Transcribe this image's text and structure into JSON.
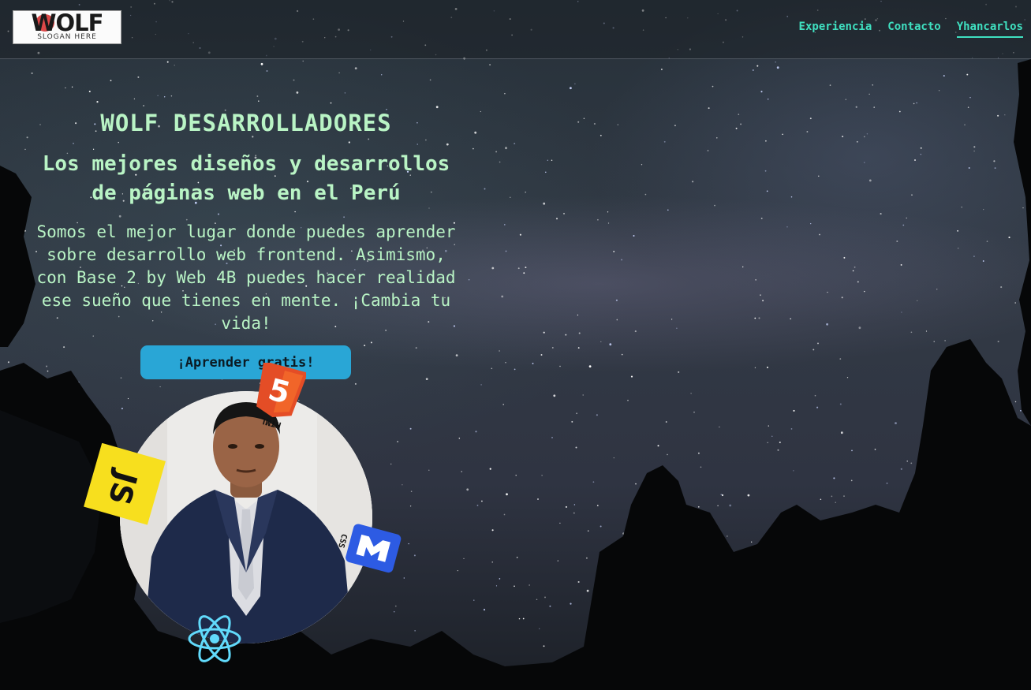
{
  "header": {
    "logo": {
      "word": "WOLF",
      "slogan": "SLOGAN HERE"
    },
    "nav": [
      {
        "label": "Experiencia",
        "active": false
      },
      {
        "label": "Contacto",
        "active": false
      },
      {
        "label": "Yhancarlos",
        "active": true
      }
    ]
  },
  "hero": {
    "title": "WOLF DESARROLLADORES",
    "subtitle": "Los mejores diseños y desarrollos de páginas web en el Perú",
    "description": "Somos el mejor lugar donde puedes aprender sobre desarrollo web frontend. Asimismo, con Base 2 by Web 4B puedes hacer realidad ese sueño que tienes en mente. ¡Cambia tu vida!",
    "cta_label": "¡Aprender gratis!"
  },
  "tech_badges": [
    {
      "icon": "html5-icon",
      "label": "HTML",
      "color": "#e44d26"
    },
    {
      "icon": "javascript-icon",
      "label": "JS",
      "color": "#f7df1e"
    },
    {
      "icon": "markdown-icon",
      "label": "CSS",
      "color": "#2d5be3"
    },
    {
      "icon": "react-icon",
      "color": "#61dafb"
    }
  ],
  "colors": {
    "accent": "#3fe0c0",
    "hero_text": "#b9f4c5",
    "cta_bg": "#29a6d6"
  }
}
